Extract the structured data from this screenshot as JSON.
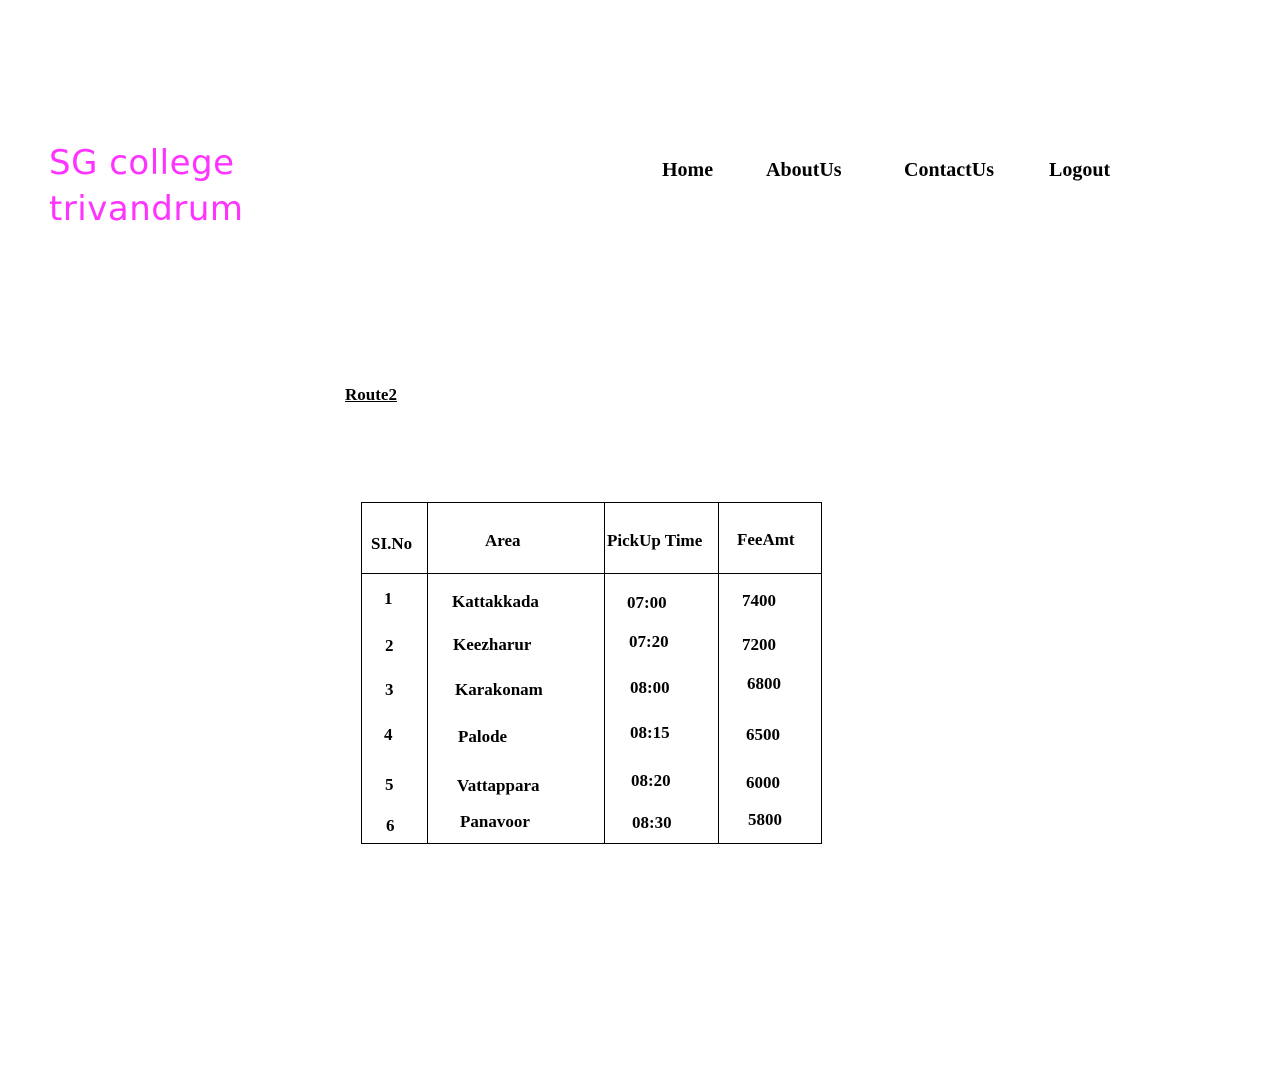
{
  "logo": {
    "line1": "SG college",
    "line2": "trivandrum"
  },
  "nav": {
    "items": [
      "Home",
      "AboutUs",
      "ContactUs",
      "Logout"
    ]
  },
  "route": {
    "title": "Route2"
  },
  "table": {
    "headers": [
      "SI.No",
      "Area",
      "PickUp Time",
      "FeeAmt"
    ],
    "rows": [
      [
        "1",
        "Kattakkada",
        "07:00",
        "7400"
      ],
      [
        "2",
        "Keezharur",
        "07:20",
        "7200"
      ],
      [
        "3",
        "Karakonam",
        "08:00",
        "6800"
      ],
      [
        "4",
        "Palode",
        "08:15",
        "6500"
      ],
      [
        "5",
        "Vattappara",
        "08:20",
        "6000"
      ],
      [
        "6",
        "Panavoor",
        "08:30",
        "5800"
      ]
    ]
  },
  "colors": {
    "logo": "#ff33ff",
    "text": "#000000",
    "background": "#ffffff"
  }
}
